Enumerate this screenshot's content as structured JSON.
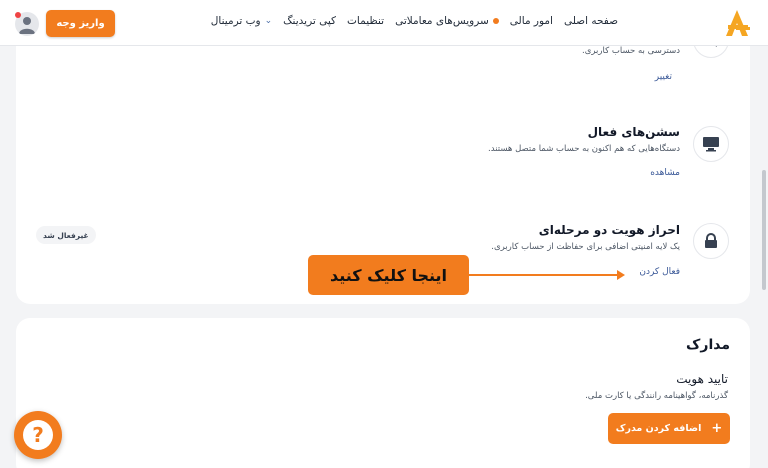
{
  "colors": {
    "accent": "#f27c1e",
    "link": "#3b5998",
    "background": "#f3f4f6",
    "card": "#ffffff"
  },
  "header": {
    "logo_icon": "arsanex-logo",
    "nav": [
      {
        "label": "صفحه اصلی"
      },
      {
        "label": "امور مالی"
      },
      {
        "label": "سرویس‌های معاملاتی",
        "has_dot": true
      },
      {
        "label": "تنظیمات"
      },
      {
        "label": "کپی تریدینگ"
      },
      {
        "label": "وب ترمینال",
        "has_chevron": true
      }
    ],
    "deposit_label": "واریز وجه",
    "avatar_icon": "user-avatar-icon"
  },
  "security": {
    "password": {
      "desc": "دسترسی به حساب کاربری.",
      "action": "تغییر",
      "icon": "key-icon"
    },
    "sessions": {
      "title": "سشن‌های فعال",
      "desc": "دستگاه‌هایی که هم اکنون به حساب شما متصل هستند.",
      "action": "مشاهده",
      "icon": "monitor-icon"
    },
    "two_factor": {
      "title": "احراز هویت دو مرحله‌ای",
      "desc": "یک لایه امنیتی اضافی برای حفاظت از حساب کاربری.",
      "action": "فعال کردن",
      "status": "غیرفعال شد",
      "icon": "lock-icon"
    }
  },
  "callout": {
    "label": "اینجا کلیک کنید"
  },
  "documents": {
    "title": "مدارک",
    "identity": {
      "title": "تایید هویت",
      "desc": "گذرنامه، گواهینامه رانندگی یا کارت ملی.",
      "add_label": "اضافه کردن مدرک",
      "add_icon": "plus-icon"
    }
  },
  "help": {
    "icon": "question-chat-icon"
  }
}
